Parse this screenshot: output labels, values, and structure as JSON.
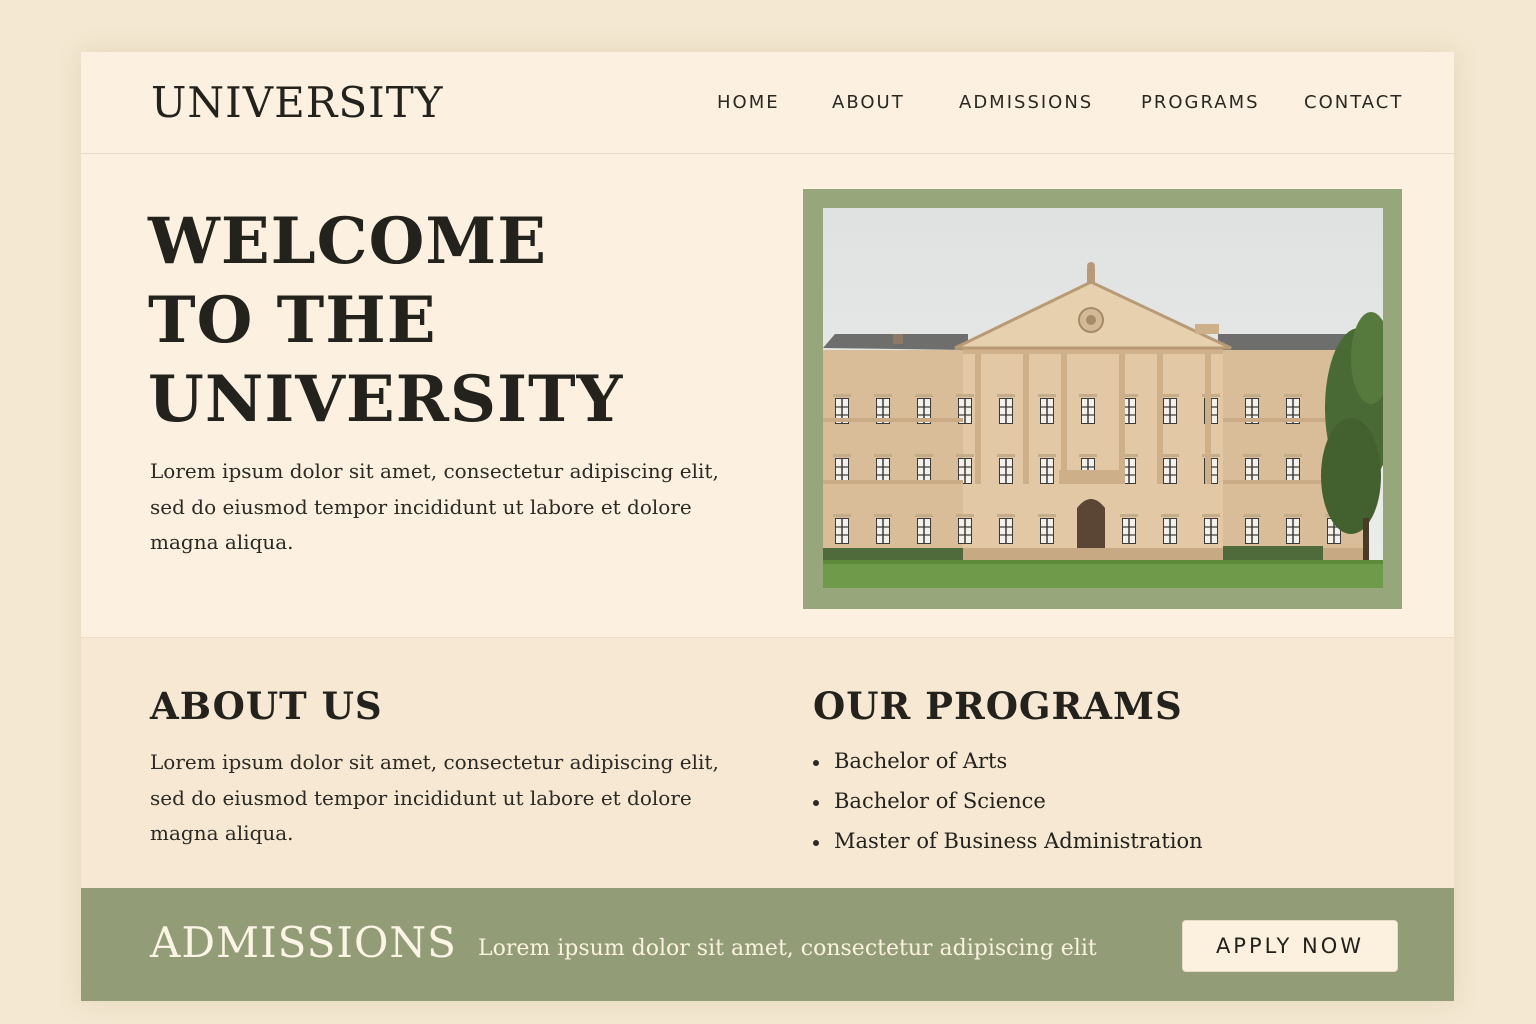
{
  "header": {
    "logo": "UNIVERSITY",
    "nav": [
      "HOME",
      "ABOUT",
      "ADMISSIONS",
      "PROGRAMS",
      "CONTACT"
    ]
  },
  "hero": {
    "title_lines": [
      "WELCOME",
      "TO THE",
      "UNIVERSITY"
    ],
    "text": "Lorem ipsum dolor sit amet, consectetur adipiscing elit, sed do eiusmod tempor incididunt ut labore et dolore magna aliqua."
  },
  "about": {
    "title": "ABOUT US",
    "text": "Lorem ipsum dolor sit amet, consectetur adipiscing elit, sed do eiusmod tempor incididunt ut labore et dolore magna aliqua."
  },
  "programs": {
    "title": "OUR PROGRAMS",
    "items": [
      "Bachelor of Arts",
      "Bachelor of Science",
      "Master of Business Administration"
    ]
  },
  "admissions": {
    "title": "ADMISSIONS",
    "text": "Lorem ipsum dolor sit amet, consectetur adipiscing elit",
    "button": "APPLY NOW"
  },
  "colors": {
    "background": "#f4e8d2",
    "page": "#fcf1e0",
    "accent_green": "#929d78",
    "frame_green": "#97a67b",
    "text": "#23221d"
  }
}
